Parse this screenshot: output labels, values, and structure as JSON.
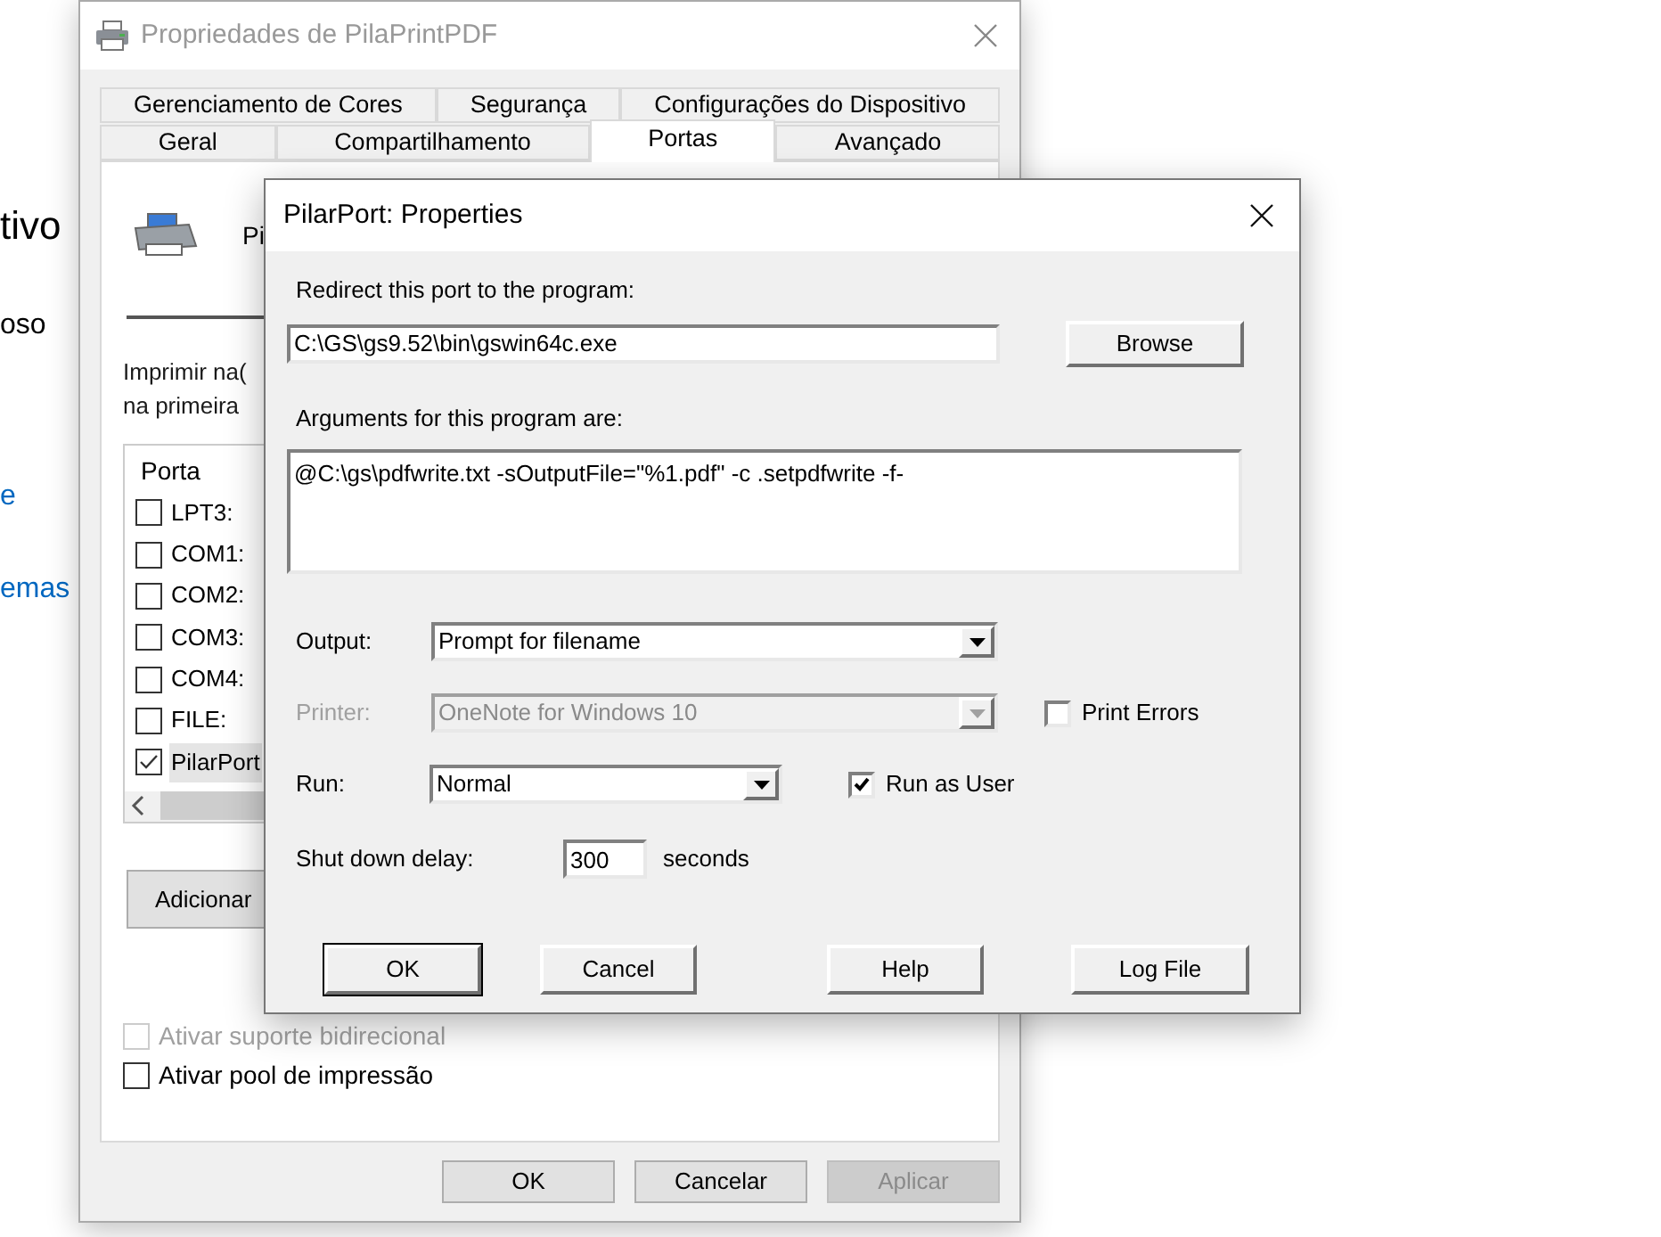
{
  "background_page": {
    "texts": [
      {
        "text": "tivo",
        "kind": "heading"
      },
      {
        "text": "oso",
        "kind": "body"
      },
      {
        "text": "e",
        "kind": "link"
      },
      {
        "text": "emas",
        "kind": "link"
      }
    ]
  },
  "properties_window": {
    "title": "Propriedades de PilaPrintPDF",
    "tab_rows": [
      [
        {
          "label": "Gerenciamento de Cores",
          "selected": false
        },
        {
          "label": "Segurança",
          "selected": false
        },
        {
          "label": "Configurações do Dispositivo",
          "selected": false
        }
      ],
      [
        {
          "label": "Geral",
          "selected": false
        },
        {
          "label": "Compartilhamento",
          "selected": false
        },
        {
          "label": "Portas",
          "selected": true
        },
        {
          "label": "Avançado",
          "selected": false
        }
      ]
    ],
    "printer_name": "Pi",
    "description_lines": [
      "Imprimir na(",
      "na primeira"
    ],
    "port_list": {
      "column": "Porta",
      "ports": [
        {
          "label": "LPT3:",
          "checked": false,
          "selected": false
        },
        {
          "label": "COM1:",
          "checked": false,
          "selected": false
        },
        {
          "label": "COM2:",
          "checked": false,
          "selected": false
        },
        {
          "label": "COM3:",
          "checked": false,
          "selected": false
        },
        {
          "label": "COM4:",
          "checked": false,
          "selected": false
        },
        {
          "label": "FILE:",
          "checked": false,
          "selected": false
        },
        {
          "label": "PilarPort",
          "checked": true,
          "selected": true
        }
      ]
    },
    "add_button": "Adicionar",
    "options": [
      {
        "label": "Ativar suporte bidirecional",
        "checked": false,
        "disabled": true
      },
      {
        "label": "Ativar pool de impressão",
        "checked": false,
        "disabled": false
      }
    ],
    "buttons": [
      {
        "label": "OK",
        "disabled": false
      },
      {
        "label": "Cancelar",
        "disabled": false
      },
      {
        "label": "Aplicar",
        "disabled": true
      }
    ]
  },
  "dialog": {
    "title": "PilarPort: Properties",
    "program_label": "Redirect this port to the program:",
    "program_value": "C:\\GS\\gs9.52\\bin\\gswin64c.exe",
    "browse_button": "Browse",
    "arguments_label": "Arguments for this program are:",
    "arguments_value": "@C:\\gs\\pdfwrite.txt -sOutputFile=\"%1.pdf\" -c .setpdfwrite -f-",
    "output": {
      "label": "Output:",
      "value": "Prompt for filename",
      "disabled": false
    },
    "printer": {
      "label": "Printer:",
      "value": "OneNote for Windows 10",
      "disabled": true
    },
    "print_errors": {
      "label": "Print Errors",
      "checked": false
    },
    "run": {
      "label": "Run:",
      "value": "Normal",
      "disabled": false
    },
    "run_as_user": {
      "label": "Run as User",
      "checked": true
    },
    "shutdown": {
      "label": "Shut down delay:",
      "value": "300",
      "unit": "seconds"
    },
    "buttons": [
      {
        "label": "OK",
        "default": true
      },
      {
        "label": "Cancel",
        "default": false
      },
      {
        "label": "Help",
        "default": false
      },
      {
        "label": "Log File",
        "default": false
      }
    ]
  }
}
